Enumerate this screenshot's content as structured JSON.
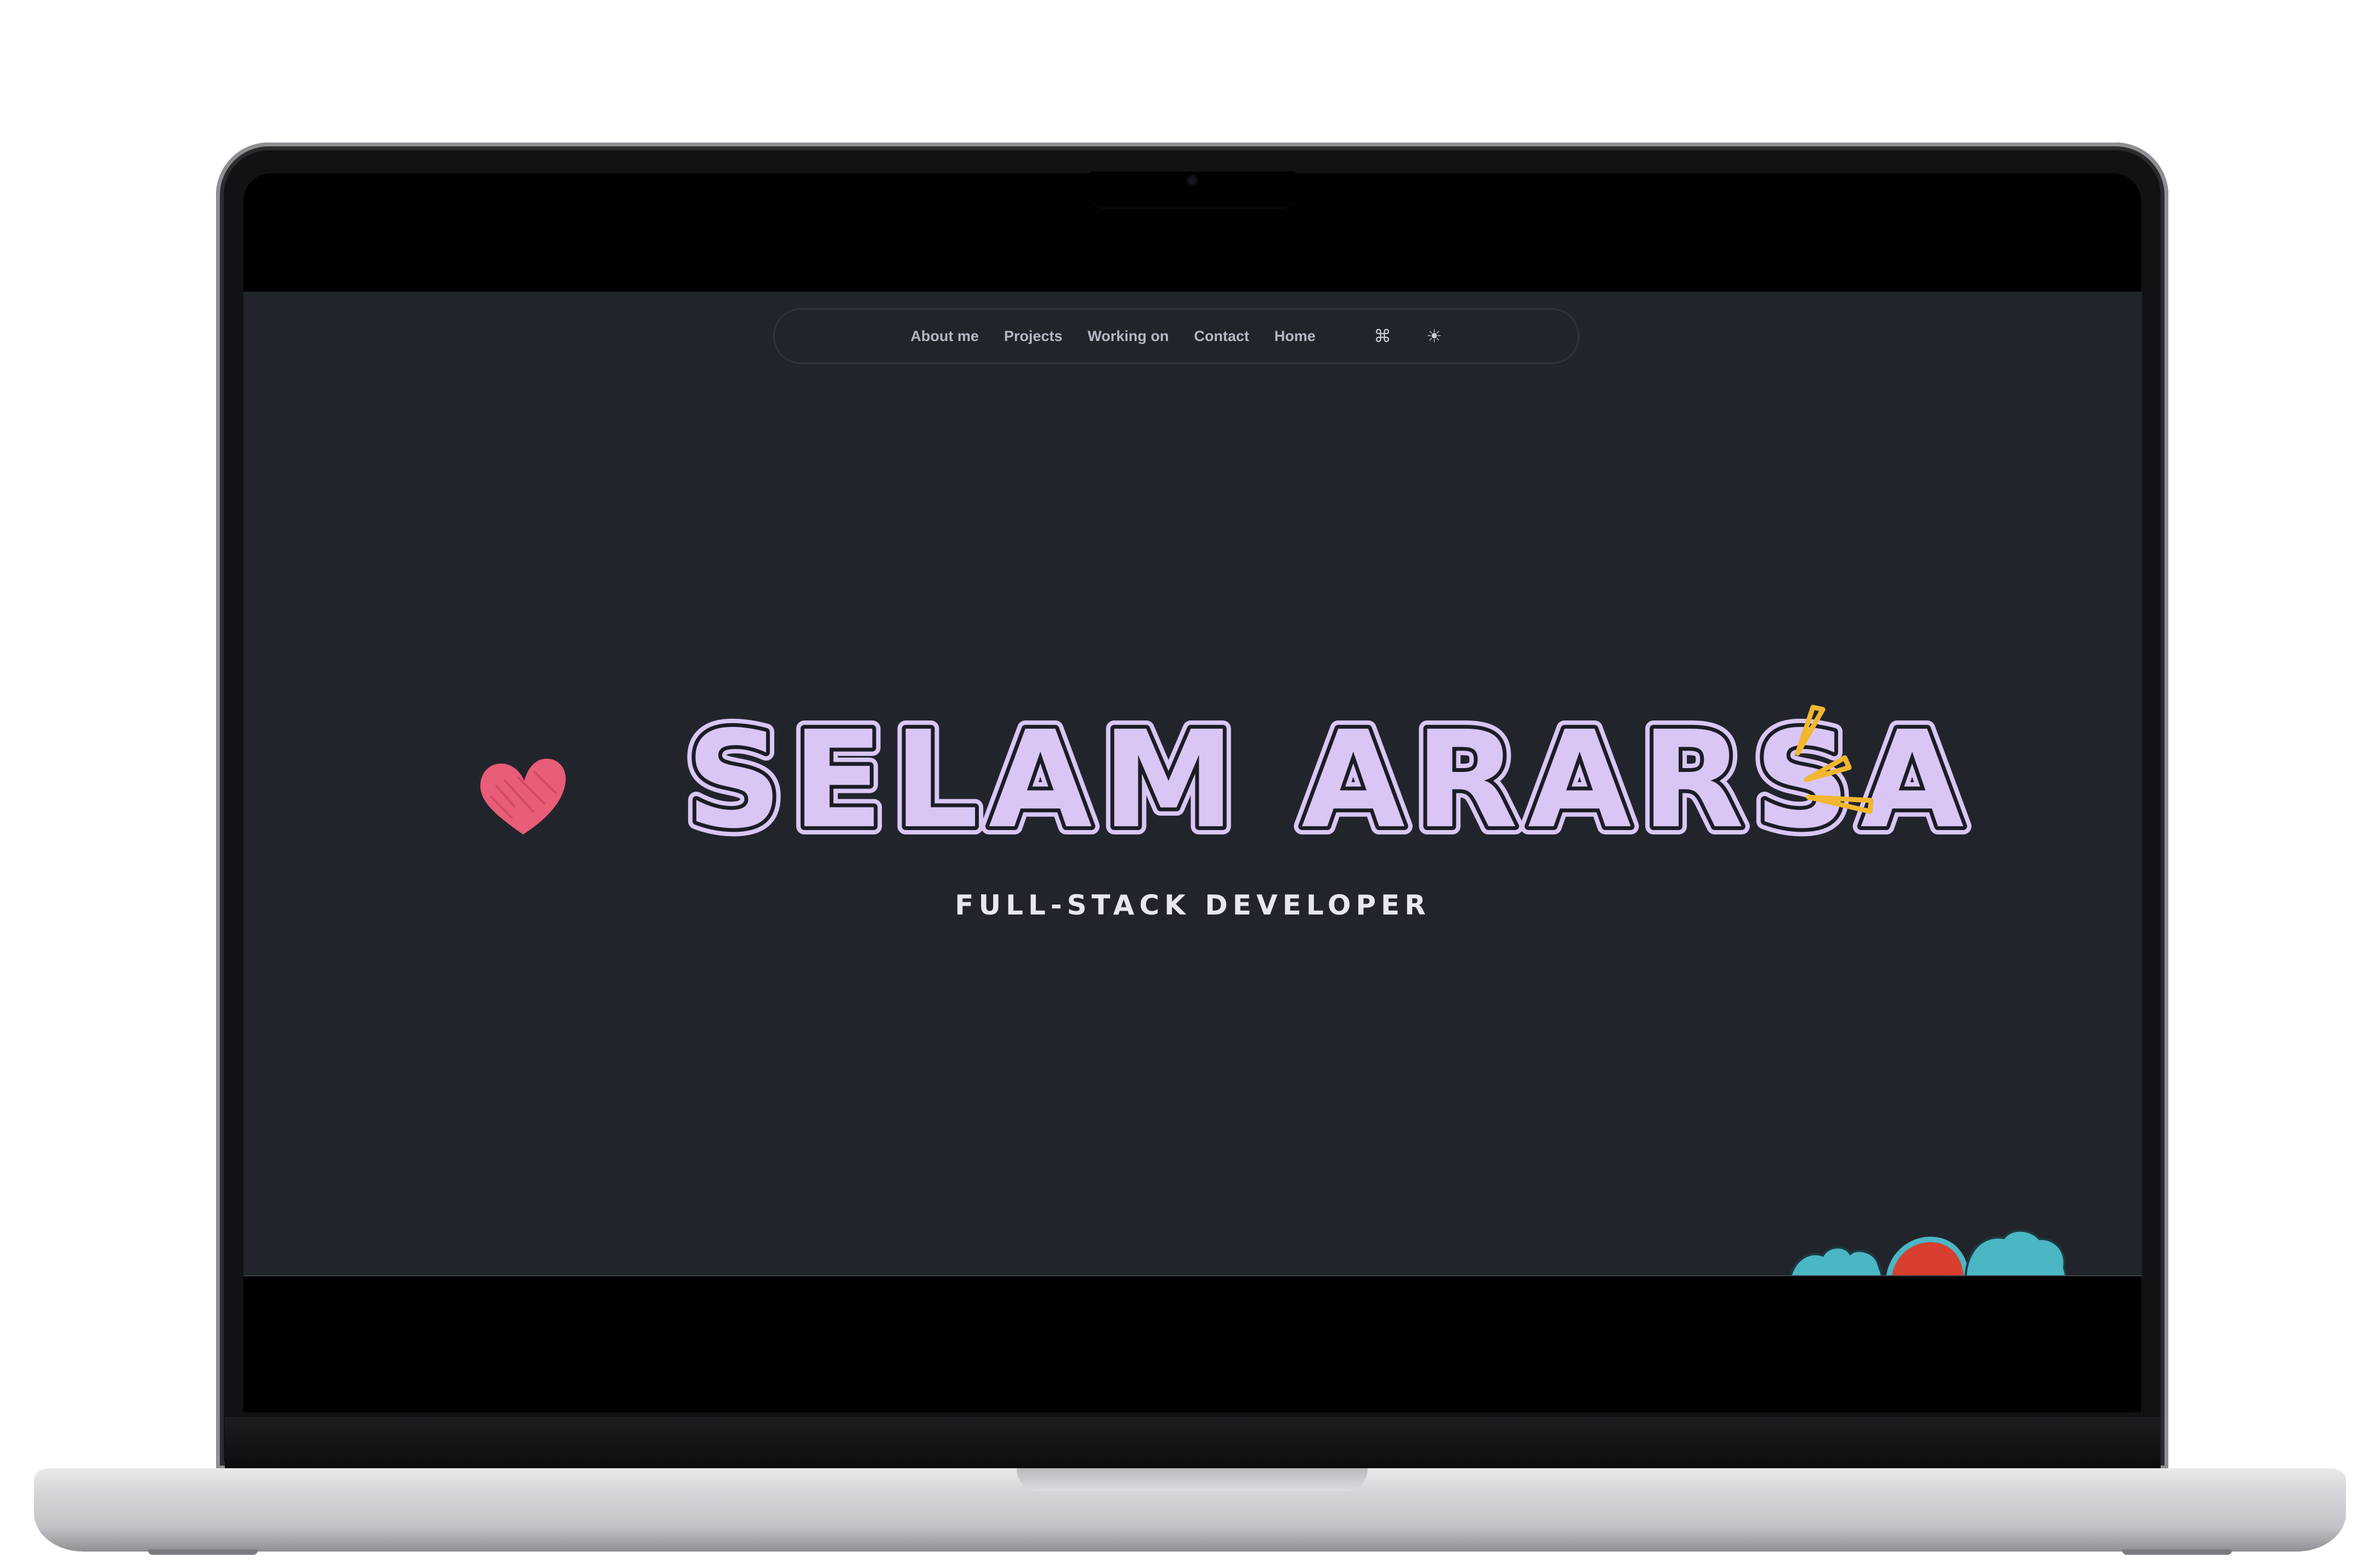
{
  "nav": {
    "links": [
      "About me",
      "Projects",
      "Working on",
      "Contact",
      "Home"
    ],
    "command_icon": "⌘",
    "theme_icon": "☀"
  },
  "hero": {
    "name": "SELAM ARARSA",
    "subtitle": "FULL-STACK DEVELOPER"
  },
  "icons": {
    "command": "command-icon",
    "theme": "sun-icon",
    "heart": "heart-doodle",
    "sparkle": "sparkle-doodle",
    "bottom": "flower-doodle"
  },
  "colors": {
    "background": "#22242c",
    "name_fill": "#d9c6f5",
    "name_outline": "#1c1d24",
    "subtitle": "#e7e8ef",
    "heart": "#e85d78",
    "sparkle": "#f2b72e",
    "doodle_teal": "#4bb6c4",
    "doodle_red": "#d7402f"
  }
}
